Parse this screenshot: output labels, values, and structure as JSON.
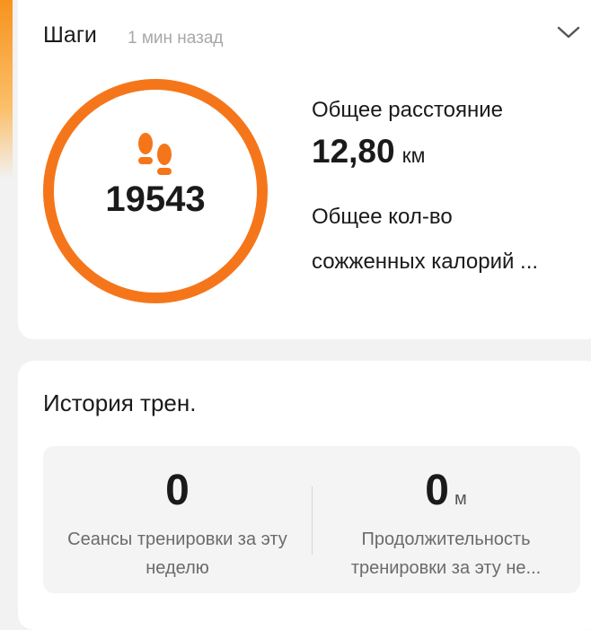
{
  "steps": {
    "title": "Шаги",
    "updated": "1 мин назад",
    "count": "19543",
    "distance_label": "Общее расстояние",
    "distance_value": "12,80",
    "distance_unit": "км",
    "calories_label_line1": "Общее кол-во",
    "calories_label_line2": "сожженных калорий ...",
    "ring_color": "#f5761a",
    "icon": "footsteps-icon"
  },
  "history": {
    "title": "История трен.",
    "sessions": {
      "value": "0",
      "description": "Сеансы тренировки за эту неделю"
    },
    "duration": {
      "value": "0",
      "unit": "м",
      "description": "Продолжительность тренировки за эту не..."
    }
  },
  "colors": {
    "accent": "#f5761a",
    "background": "#f2f2f2",
    "card": "#ffffff"
  }
}
